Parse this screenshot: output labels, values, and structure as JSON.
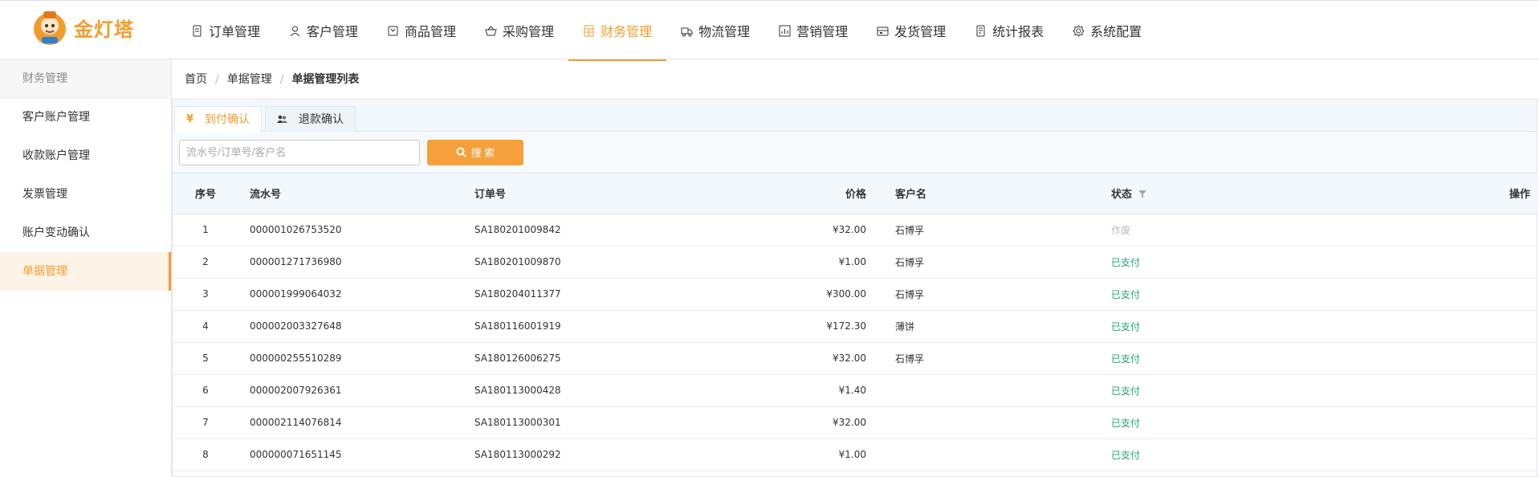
{
  "app": {
    "logo_text": "金灯塔"
  },
  "nav": [
    {
      "label": "订单管理",
      "icon": "file-icon",
      "active": false
    },
    {
      "label": "客户管理",
      "icon": "user-icon",
      "active": false
    },
    {
      "label": "商品管理",
      "icon": "product-icon",
      "active": false
    },
    {
      "label": "采购管理",
      "icon": "basket-icon",
      "active": false
    },
    {
      "label": "财务管理",
      "icon": "calculator-icon",
      "active": true
    },
    {
      "label": "物流管理",
      "icon": "truck-icon",
      "active": false
    },
    {
      "label": "营销管理",
      "icon": "chart-icon",
      "active": false
    },
    {
      "label": "发货管理",
      "icon": "ship-icon",
      "active": false
    },
    {
      "label": "统计报表",
      "icon": "report-icon",
      "active": false
    },
    {
      "label": "系统配置",
      "icon": "gear-icon",
      "active": false
    }
  ],
  "sidebar": {
    "title": "财务管理",
    "items": [
      {
        "label": "客户账户管理",
        "active": false
      },
      {
        "label": "收款账户管理",
        "active": false
      },
      {
        "label": "发票管理",
        "active": false
      },
      {
        "label": "账户变动确认",
        "active": false
      },
      {
        "label": "单据管理",
        "active": true
      }
    ]
  },
  "breadcrumb": {
    "home": "首页",
    "section": "单据管理",
    "current": "单据管理列表"
  },
  "tabs": [
    {
      "label": "到付确认",
      "icon": "yen-icon",
      "active": true
    },
    {
      "label": "退款确认",
      "icon": "users-icon",
      "active": false
    }
  ],
  "search": {
    "placeholder": "流水号/订单号/客户名",
    "button_label": "搜 索"
  },
  "table": {
    "headers": {
      "index": "序号",
      "serial": "流水号",
      "order": "订单号",
      "price": "价格",
      "customer": "客户名",
      "status": "状态",
      "action": "操作"
    },
    "rows": [
      {
        "index": "1",
        "serial": "000001026753520",
        "order": "SA180201009842",
        "price": "¥32.00",
        "customer": "石博孚",
        "status": "作废",
        "status_type": "void"
      },
      {
        "index": "2",
        "serial": "000001271736980",
        "order": "SA180201009870",
        "price": "¥1.00",
        "customer": "石博孚",
        "status": "已支付",
        "status_type": "paid"
      },
      {
        "index": "3",
        "serial": "000001999064032",
        "order": "SA180204011377",
        "price": "¥300.00",
        "customer": "石博孚",
        "status": "已支付",
        "status_type": "paid"
      },
      {
        "index": "4",
        "serial": "000002003327648",
        "order": "SA180116001919",
        "price": "¥172.30",
        "customer": "薄饼",
        "status": "已支付",
        "status_type": "paid"
      },
      {
        "index": "5",
        "serial": "000000255510289",
        "order": "SA180126006275",
        "price": "¥32.00",
        "customer": "石博孚",
        "status": "已支付",
        "status_type": "paid"
      },
      {
        "index": "6",
        "serial": "000002007926361",
        "order": "SA180113000428",
        "price": "¥1.40",
        "customer": "",
        "status": "已支付",
        "status_type": "paid"
      },
      {
        "index": "7",
        "serial": "000002114076814",
        "order": "SA180113000301",
        "price": "¥32.00",
        "customer": "",
        "status": "已支付",
        "status_type": "paid"
      },
      {
        "index": "8",
        "serial": "000000071651145",
        "order": "SA180113000292",
        "price": "¥1.00",
        "customer": "",
        "status": "已支付",
        "status_type": "paid"
      }
    ]
  },
  "colors": {
    "accent": "#f39c2d",
    "paid": "#1aa86b",
    "void": "#bbbbbb"
  }
}
